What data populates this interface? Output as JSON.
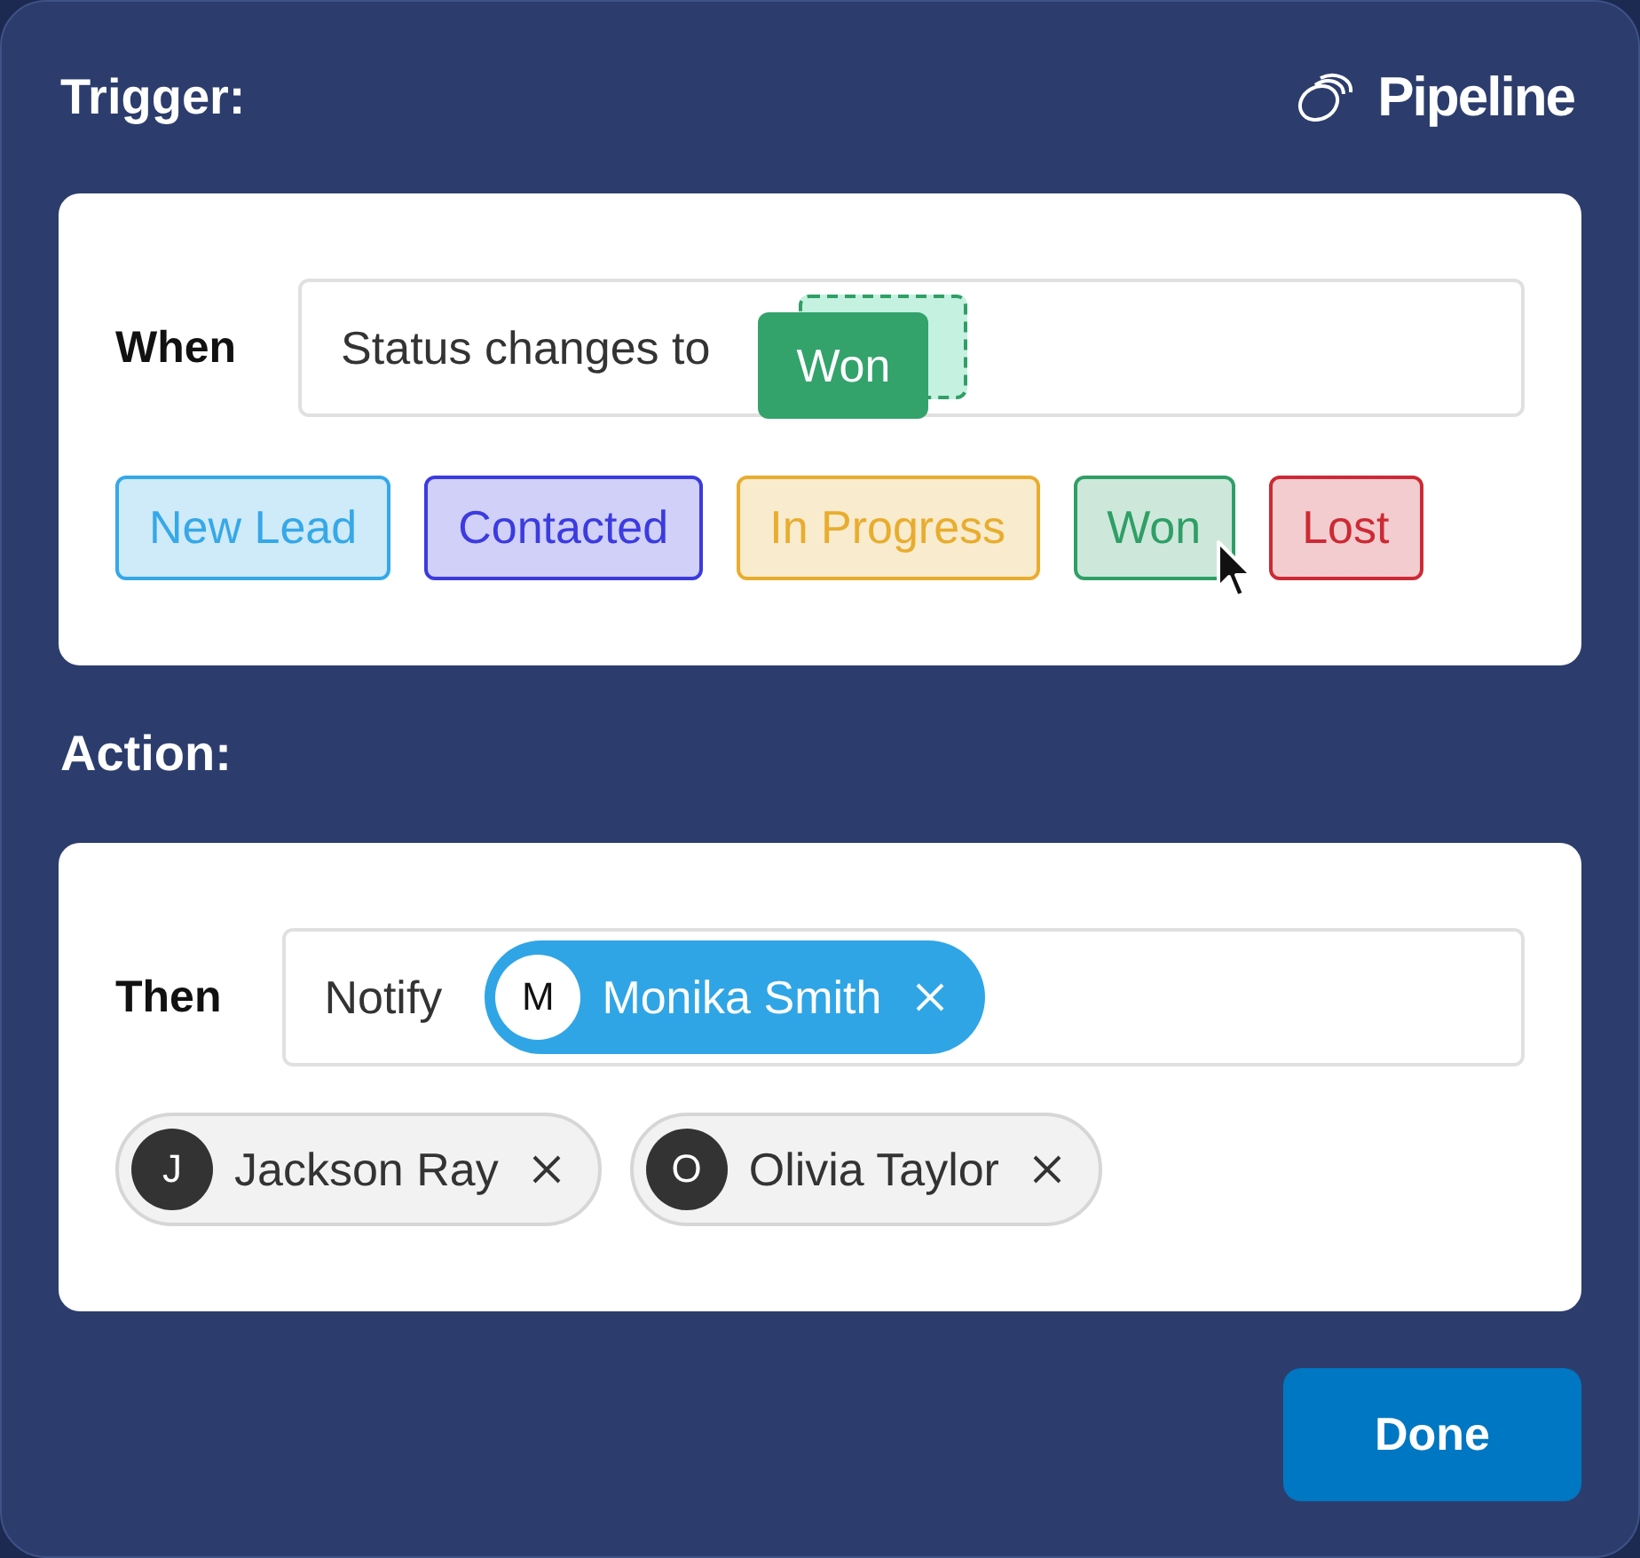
{
  "header": {
    "title": "Trigger:",
    "logo": "Pipeline"
  },
  "trigger": {
    "label": "When",
    "field": {
      "text": "Status changes to",
      "dropped_status": {
        "label": "Won",
        "color": "#33a36b"
      }
    },
    "statuses": [
      {
        "label": "New Lead",
        "color": "#35a8e8",
        "hovered": false
      },
      {
        "label": "Contacted",
        "color": "#3b3be0",
        "hovered": false
      },
      {
        "label": "In Progress",
        "color": "#e8ad2f",
        "hovered": false
      },
      {
        "label": "Won",
        "color": "#2f9f66",
        "hovered": true
      },
      {
        "label": "Lost",
        "color": "#cc2a35",
        "hovered": false
      }
    ]
  },
  "action_title": "Action:",
  "action": {
    "label": "Then",
    "field": {
      "text": "Notify",
      "recipients": [
        {
          "initial": "M",
          "name": "Monika Smith"
        }
      ]
    },
    "suggestions": [
      {
        "initial": "J",
        "name": "Jackson Ray"
      },
      {
        "initial": "O",
        "name": "Olivia Taylor"
      }
    ]
  },
  "done_button": "Done"
}
